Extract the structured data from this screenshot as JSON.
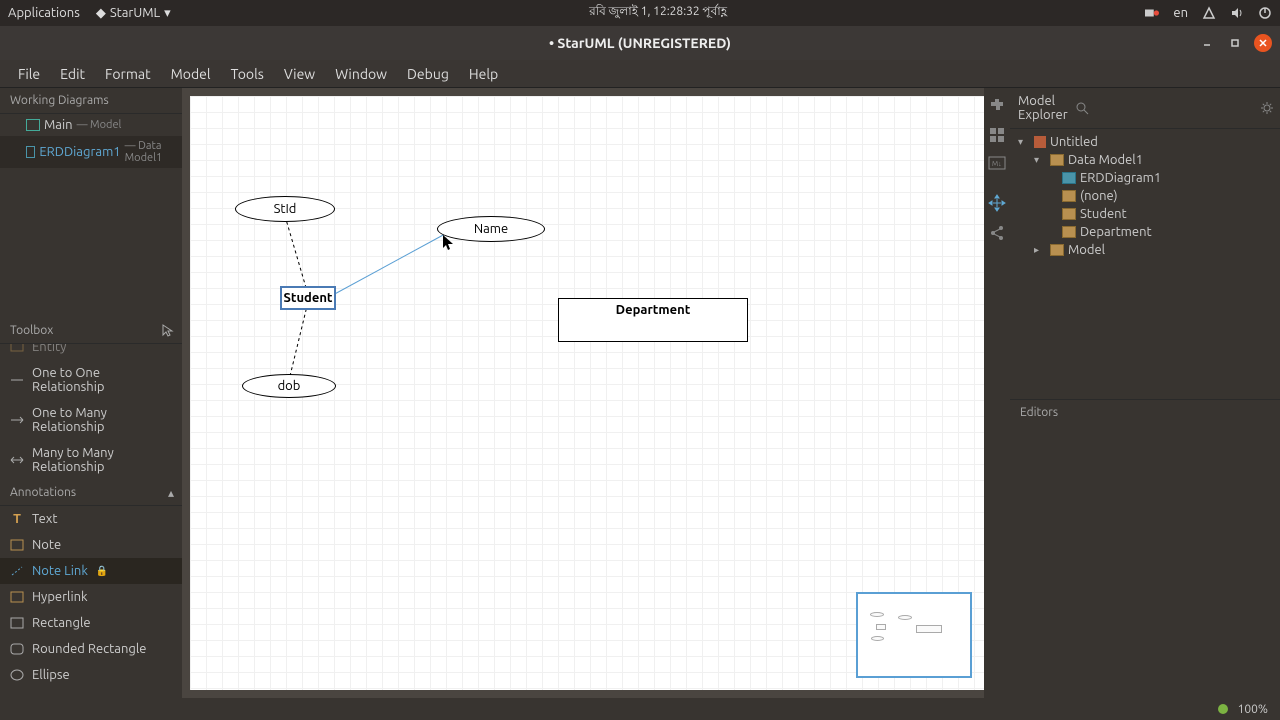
{
  "os": {
    "applications": "Applications",
    "app_name": "StarUML",
    "datetime": "রবি জুলাই  1, 12:28:32 পূর্বাহ্ণ",
    "lang": "en"
  },
  "window": {
    "title": "• StarUML (UNREGISTERED)"
  },
  "menu": [
    "File",
    "Edit",
    "Format",
    "Model",
    "Tools",
    "View",
    "Window",
    "Debug",
    "Help"
  ],
  "working_diagrams": {
    "header": "Working Diagrams",
    "items": [
      {
        "name": "Main",
        "sub": "— Model"
      },
      {
        "name": "ERDDiagram1",
        "sub": "— Data Model1"
      }
    ]
  },
  "toolbox": {
    "header": "Toolbox",
    "tools_top": [
      "Entity",
      "One to One Relationship",
      "One to Many Relationship",
      "Many to Many Relationship"
    ],
    "annotations_header": "Annotations",
    "annotations": [
      "Text",
      "Note",
      "Note Link",
      "Hyperlink",
      "Rectangle",
      "Rounded Rectangle",
      "Ellipse"
    ]
  },
  "diagram": {
    "shapes": {
      "stid": "StId",
      "name": "Name",
      "student": "Student",
      "dob": "dob",
      "department": "Department"
    }
  },
  "explorer": {
    "header": "Model Explorer",
    "search_placeholder": "",
    "tree": {
      "root": "Untitled",
      "data_model": "Data Model1",
      "erd": "ERDDiagram1",
      "none": "(none)",
      "student": "Student",
      "department": "Department",
      "model": "Model"
    }
  },
  "editors": {
    "header": "Editors"
  },
  "status": {
    "zoom": "100%"
  }
}
